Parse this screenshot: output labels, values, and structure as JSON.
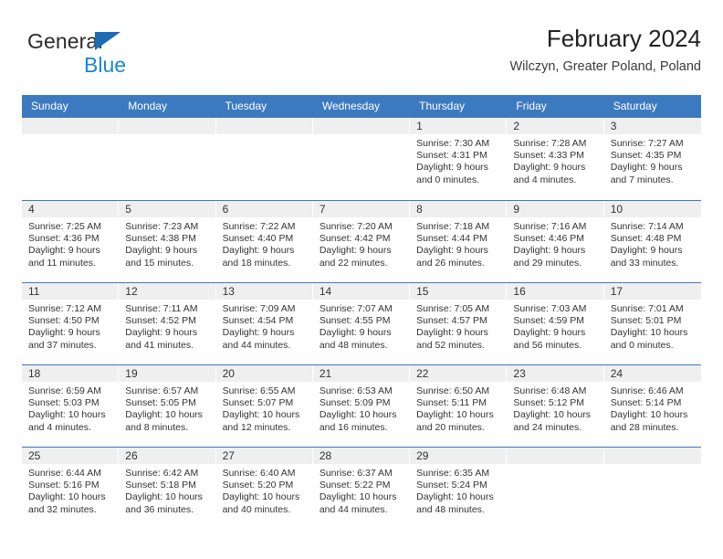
{
  "brand": {
    "name_part1": "General",
    "name_part2": "Blue",
    "triangle_icon": "blue-triangle-icon",
    "color_dark": "#2b2b2b",
    "color_blue": "#1b86d4"
  },
  "header": {
    "title": "February 2024",
    "subtitle": "Wilczyn, Greater Poland, Poland"
  },
  "theme": {
    "header_blue": "#3c7ac0",
    "day_band_gray": "#efefef",
    "text_color": "#333333"
  },
  "weekdays": [
    "Sunday",
    "Monday",
    "Tuesday",
    "Wednesday",
    "Thursday",
    "Friday",
    "Saturday"
  ],
  "weeks": [
    [
      {
        "day": "",
        "sunrise": "",
        "sunset": "",
        "daylight_line1": "",
        "daylight_line2": ""
      },
      {
        "day": "",
        "sunrise": "",
        "sunset": "",
        "daylight_line1": "",
        "daylight_line2": ""
      },
      {
        "day": "",
        "sunrise": "",
        "sunset": "",
        "daylight_line1": "",
        "daylight_line2": ""
      },
      {
        "day": "",
        "sunrise": "",
        "sunset": "",
        "daylight_line1": "",
        "daylight_line2": ""
      },
      {
        "day": "1",
        "sunrise": "Sunrise: 7:30 AM",
        "sunset": "Sunset: 4:31 PM",
        "daylight_line1": "Daylight: 9 hours",
        "daylight_line2": "and 0 minutes."
      },
      {
        "day": "2",
        "sunrise": "Sunrise: 7:28 AM",
        "sunset": "Sunset: 4:33 PM",
        "daylight_line1": "Daylight: 9 hours",
        "daylight_line2": "and 4 minutes."
      },
      {
        "day": "3",
        "sunrise": "Sunrise: 7:27 AM",
        "sunset": "Sunset: 4:35 PM",
        "daylight_line1": "Daylight: 9 hours",
        "daylight_line2": "and 7 minutes."
      }
    ],
    [
      {
        "day": "4",
        "sunrise": "Sunrise: 7:25 AM",
        "sunset": "Sunset: 4:36 PM",
        "daylight_line1": "Daylight: 9 hours",
        "daylight_line2": "and 11 minutes."
      },
      {
        "day": "5",
        "sunrise": "Sunrise: 7:23 AM",
        "sunset": "Sunset: 4:38 PM",
        "daylight_line1": "Daylight: 9 hours",
        "daylight_line2": "and 15 minutes."
      },
      {
        "day": "6",
        "sunrise": "Sunrise: 7:22 AM",
        "sunset": "Sunset: 4:40 PM",
        "daylight_line1": "Daylight: 9 hours",
        "daylight_line2": "and 18 minutes."
      },
      {
        "day": "7",
        "sunrise": "Sunrise: 7:20 AM",
        "sunset": "Sunset: 4:42 PM",
        "daylight_line1": "Daylight: 9 hours",
        "daylight_line2": "and 22 minutes."
      },
      {
        "day": "8",
        "sunrise": "Sunrise: 7:18 AM",
        "sunset": "Sunset: 4:44 PM",
        "daylight_line1": "Daylight: 9 hours",
        "daylight_line2": "and 26 minutes."
      },
      {
        "day": "9",
        "sunrise": "Sunrise: 7:16 AM",
        "sunset": "Sunset: 4:46 PM",
        "daylight_line1": "Daylight: 9 hours",
        "daylight_line2": "and 29 minutes."
      },
      {
        "day": "10",
        "sunrise": "Sunrise: 7:14 AM",
        "sunset": "Sunset: 4:48 PM",
        "daylight_line1": "Daylight: 9 hours",
        "daylight_line2": "and 33 minutes."
      }
    ],
    [
      {
        "day": "11",
        "sunrise": "Sunrise: 7:12 AM",
        "sunset": "Sunset: 4:50 PM",
        "daylight_line1": "Daylight: 9 hours",
        "daylight_line2": "and 37 minutes."
      },
      {
        "day": "12",
        "sunrise": "Sunrise: 7:11 AM",
        "sunset": "Sunset: 4:52 PM",
        "daylight_line1": "Daylight: 9 hours",
        "daylight_line2": "and 41 minutes."
      },
      {
        "day": "13",
        "sunrise": "Sunrise: 7:09 AM",
        "sunset": "Sunset: 4:54 PM",
        "daylight_line1": "Daylight: 9 hours",
        "daylight_line2": "and 44 minutes."
      },
      {
        "day": "14",
        "sunrise": "Sunrise: 7:07 AM",
        "sunset": "Sunset: 4:55 PM",
        "daylight_line1": "Daylight: 9 hours",
        "daylight_line2": "and 48 minutes."
      },
      {
        "day": "15",
        "sunrise": "Sunrise: 7:05 AM",
        "sunset": "Sunset: 4:57 PM",
        "daylight_line1": "Daylight: 9 hours",
        "daylight_line2": "and 52 minutes."
      },
      {
        "day": "16",
        "sunrise": "Sunrise: 7:03 AM",
        "sunset": "Sunset: 4:59 PM",
        "daylight_line1": "Daylight: 9 hours",
        "daylight_line2": "and 56 minutes."
      },
      {
        "day": "17",
        "sunrise": "Sunrise: 7:01 AM",
        "sunset": "Sunset: 5:01 PM",
        "daylight_line1": "Daylight: 10 hours",
        "daylight_line2": "and 0 minutes."
      }
    ],
    [
      {
        "day": "18",
        "sunrise": "Sunrise: 6:59 AM",
        "sunset": "Sunset: 5:03 PM",
        "daylight_line1": "Daylight: 10 hours",
        "daylight_line2": "and 4 minutes."
      },
      {
        "day": "19",
        "sunrise": "Sunrise: 6:57 AM",
        "sunset": "Sunset: 5:05 PM",
        "daylight_line1": "Daylight: 10 hours",
        "daylight_line2": "and 8 minutes."
      },
      {
        "day": "20",
        "sunrise": "Sunrise: 6:55 AM",
        "sunset": "Sunset: 5:07 PM",
        "daylight_line1": "Daylight: 10 hours",
        "daylight_line2": "and 12 minutes."
      },
      {
        "day": "21",
        "sunrise": "Sunrise: 6:53 AM",
        "sunset": "Sunset: 5:09 PM",
        "daylight_line1": "Daylight: 10 hours",
        "daylight_line2": "and 16 minutes."
      },
      {
        "day": "22",
        "sunrise": "Sunrise: 6:50 AM",
        "sunset": "Sunset: 5:11 PM",
        "daylight_line1": "Daylight: 10 hours",
        "daylight_line2": "and 20 minutes."
      },
      {
        "day": "23",
        "sunrise": "Sunrise: 6:48 AM",
        "sunset": "Sunset: 5:12 PM",
        "daylight_line1": "Daylight: 10 hours",
        "daylight_line2": "and 24 minutes."
      },
      {
        "day": "24",
        "sunrise": "Sunrise: 6:46 AM",
        "sunset": "Sunset: 5:14 PM",
        "daylight_line1": "Daylight: 10 hours",
        "daylight_line2": "and 28 minutes."
      }
    ],
    [
      {
        "day": "25",
        "sunrise": "Sunrise: 6:44 AM",
        "sunset": "Sunset: 5:16 PM",
        "daylight_line1": "Daylight: 10 hours",
        "daylight_line2": "and 32 minutes."
      },
      {
        "day": "26",
        "sunrise": "Sunrise: 6:42 AM",
        "sunset": "Sunset: 5:18 PM",
        "daylight_line1": "Daylight: 10 hours",
        "daylight_line2": "and 36 minutes."
      },
      {
        "day": "27",
        "sunrise": "Sunrise: 6:40 AM",
        "sunset": "Sunset: 5:20 PM",
        "daylight_line1": "Daylight: 10 hours",
        "daylight_line2": "and 40 minutes."
      },
      {
        "day": "28",
        "sunrise": "Sunrise: 6:37 AM",
        "sunset": "Sunset: 5:22 PM",
        "daylight_line1": "Daylight: 10 hours",
        "daylight_line2": "and 44 minutes."
      },
      {
        "day": "29",
        "sunrise": "Sunrise: 6:35 AM",
        "sunset": "Sunset: 5:24 PM",
        "daylight_line1": "Daylight: 10 hours",
        "daylight_line2": "and 48 minutes."
      },
      {
        "day": "",
        "sunrise": "",
        "sunset": "",
        "daylight_line1": "",
        "daylight_line2": ""
      },
      {
        "day": "",
        "sunrise": "",
        "sunset": "",
        "daylight_line1": "",
        "daylight_line2": ""
      }
    ]
  ]
}
